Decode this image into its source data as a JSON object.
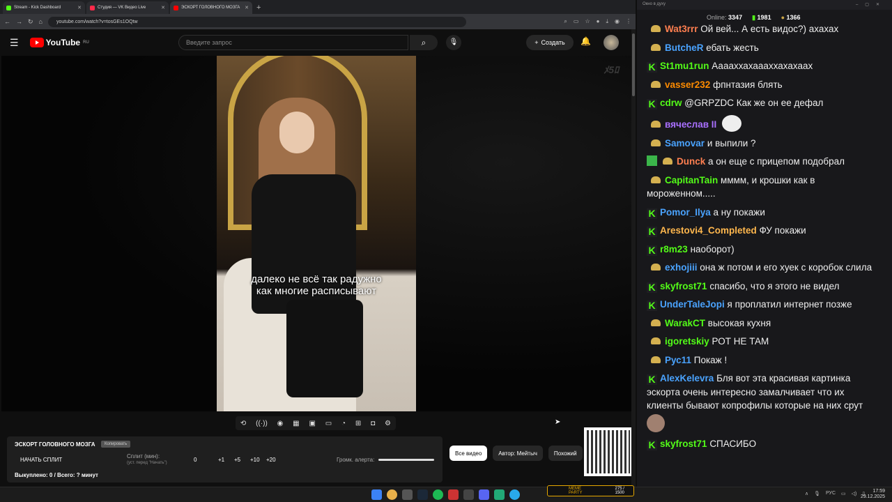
{
  "browser": {
    "tabs": [
      {
        "label": "Stream - Kick Dashboard",
        "color": "#53fc18"
      },
      {
        "label": "Студия — VK Видео Live",
        "color": "#ff2a4a"
      },
      {
        "label": "ЭСКОРТ ГОЛОВНОГО МОЗГА",
        "color": "#ff0000"
      }
    ],
    "url": "youtube.com/watch?v=tosGEs1OQtw"
  },
  "youtube": {
    "logo": "YouTube",
    "region": "RU",
    "search_placeholder": "Введите запрос",
    "create_label": "Создать",
    "subtitle_line1": "далеко не всё так радужно",
    "subtitle_line2": "как многие расписывают",
    "chips": [
      "Все видео",
      "Автор: Мейтыч",
      "Похожий"
    ]
  },
  "panel": {
    "title": "ЭСКОРТ ГОЛОВНОГО МОЗГА",
    "badge": "Копировать",
    "start_split": "НАЧАТЬ СПЛИТ",
    "split_label": "Сплит (мин):",
    "split_hint": "(уст. перед \"Начать\")",
    "split_values": [
      "0",
      "+1",
      "+5",
      "+10",
      "+20"
    ],
    "alert_volume": "Громк. алерта:",
    "bought": "Выкуплено: 0 / Всего: ? минут"
  },
  "chat_window": {
    "title": "Окно в духу",
    "online_label": "Online:",
    "online": "3347",
    "kick_count": "1981",
    "coin_count": "1366"
  },
  "chat": [
    {
      "badge": "crown",
      "user": "Wat3rrr",
      "color": "#ff7f50",
      "text": "Ой вей... А есть видос?) ахахах"
    },
    {
      "badge": "crown",
      "user": "ButcheR",
      "color": "#4aa3ff",
      "text": "ебать жесть"
    },
    {
      "badge": "kick",
      "user": "St1mu1run",
      "color": "#53fc18",
      "text": "Ааааххахаааххахахаах"
    },
    {
      "badge": "crown",
      "user": "vasser232",
      "color": "#ff8c00",
      "text": "фпнтазия блять"
    },
    {
      "badge": "kick",
      "user": "cdrw",
      "color": "#53fc18",
      "text": "@GRPZDC Как же он ее дефал"
    },
    {
      "badge": "crown",
      "user": "вячеслав II",
      "color": "#a970ff",
      "text": ""
    },
    {
      "badge": "crown",
      "user": "Samovar",
      "color": "#4aa3ff",
      "text": "и выпили ?"
    },
    {
      "badge": "pen-crown",
      "user": "Dunck",
      "color": "#ff7f50",
      "text": "а он еще с прицепом подобрал"
    },
    {
      "badge": "crown",
      "user": "CapitanTain",
      "color": "#53fc18",
      "text": "мммм, и крошки как в мороженном....."
    },
    {
      "badge": "kick",
      "user": "Pomor_Ilya",
      "color": "#4aa3ff",
      "text": "а ну покажи"
    },
    {
      "badge": "kick",
      "user": "Arestovi4_Completed",
      "color": "#ffb74d",
      "text": "ФУ покажи"
    },
    {
      "badge": "kick",
      "user": "r8m23",
      "color": "#53fc18",
      "text": "наоборот)"
    },
    {
      "badge": "crown",
      "user": "exhojiii",
      "color": "#4aa3ff",
      "text": "она ж потом и его хуек с коробок слила"
    },
    {
      "badge": "kick",
      "user": "skyfrost71",
      "color": "#53fc18",
      "text": "спасибо, что я этого не видел"
    },
    {
      "badge": "kick",
      "user": "UnderTaleJopi",
      "color": "#4aa3ff",
      "text": "я проплатил интернет позже"
    },
    {
      "badge": "crown",
      "user": "WarakCT",
      "color": "#53fc18",
      "text": "высокая кухня"
    },
    {
      "badge": "crown",
      "user": "igoretskiy",
      "color": "#53fc18",
      "text": "РОТ НЕ ТАМ"
    },
    {
      "badge": "crown",
      "user": "Рус11",
      "color": "#4aa3ff",
      "text": "Покаж !"
    },
    {
      "badge": "kick",
      "user": "AlexKelevra",
      "color": "#4aa3ff",
      "text": "Бля вот эта красивая картинка эскорта очень интересно замалчивает что их клиенты бывают копрофилы которые на них срут"
    },
    {
      "badge": "kick",
      "user": "skyfrost71",
      "color": "#53fc18",
      "text": "СПАСИБО"
    }
  ],
  "taskbar": {
    "lang": "РУС",
    "time": "17:59",
    "date": "29.12.2025",
    "meme_title": "MEME PARTY",
    "meme_count": "275 / 1500"
  }
}
